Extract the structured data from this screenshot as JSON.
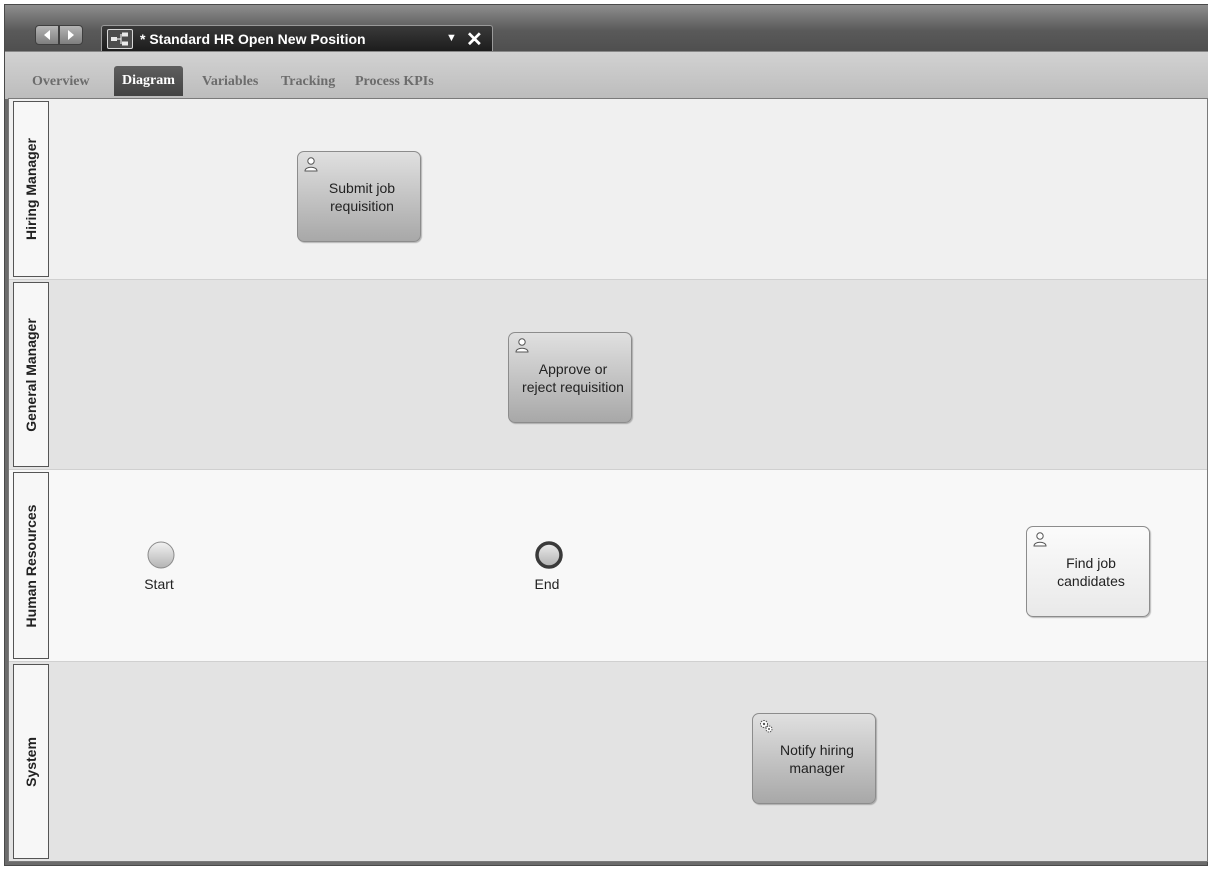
{
  "editor": {
    "document_title": "* Standard HR Open New Position",
    "document_icon": "process-diagram-icon",
    "nav_back_icon": "arrow-left-icon",
    "nav_forward_icon": "arrow-right-icon",
    "dropdown_glyph": "▼",
    "close_glyph": "✕"
  },
  "tabs": [
    {
      "label": "Overview",
      "active": false
    },
    {
      "label": "Diagram",
      "active": true
    },
    {
      "label": "Variables",
      "active": false
    },
    {
      "label": "Tracking",
      "active": false
    },
    {
      "label": "Process KPIs",
      "active": false
    }
  ],
  "lanes": [
    {
      "label": "Hiring Manager"
    },
    {
      "label": "General Manager"
    },
    {
      "label": "Human Resources"
    },
    {
      "label": "System"
    }
  ],
  "tasks": {
    "submit_job_requisition": {
      "label": "Submit job requisition",
      "type": "user-task",
      "icon": "person-icon"
    },
    "approve_or_reject_requisition": {
      "label": "Approve or reject requisition",
      "type": "user-task",
      "icon": "person-icon"
    },
    "find_job_candidates": {
      "label": "Find job candidates",
      "type": "user-task",
      "icon": "person-icon"
    },
    "notify_hiring_manager": {
      "label": "Notify hiring manager",
      "type": "system-task",
      "icon": "gears-icon"
    }
  },
  "events": {
    "start": {
      "label": "Start"
    },
    "end": {
      "label": "End"
    }
  },
  "colors": {
    "title_bar": "#5a5a5a",
    "active_tab": "#4f4f4f",
    "lane_light": "#f0f0f0",
    "lane_dark": "#e3e3e3"
  }
}
